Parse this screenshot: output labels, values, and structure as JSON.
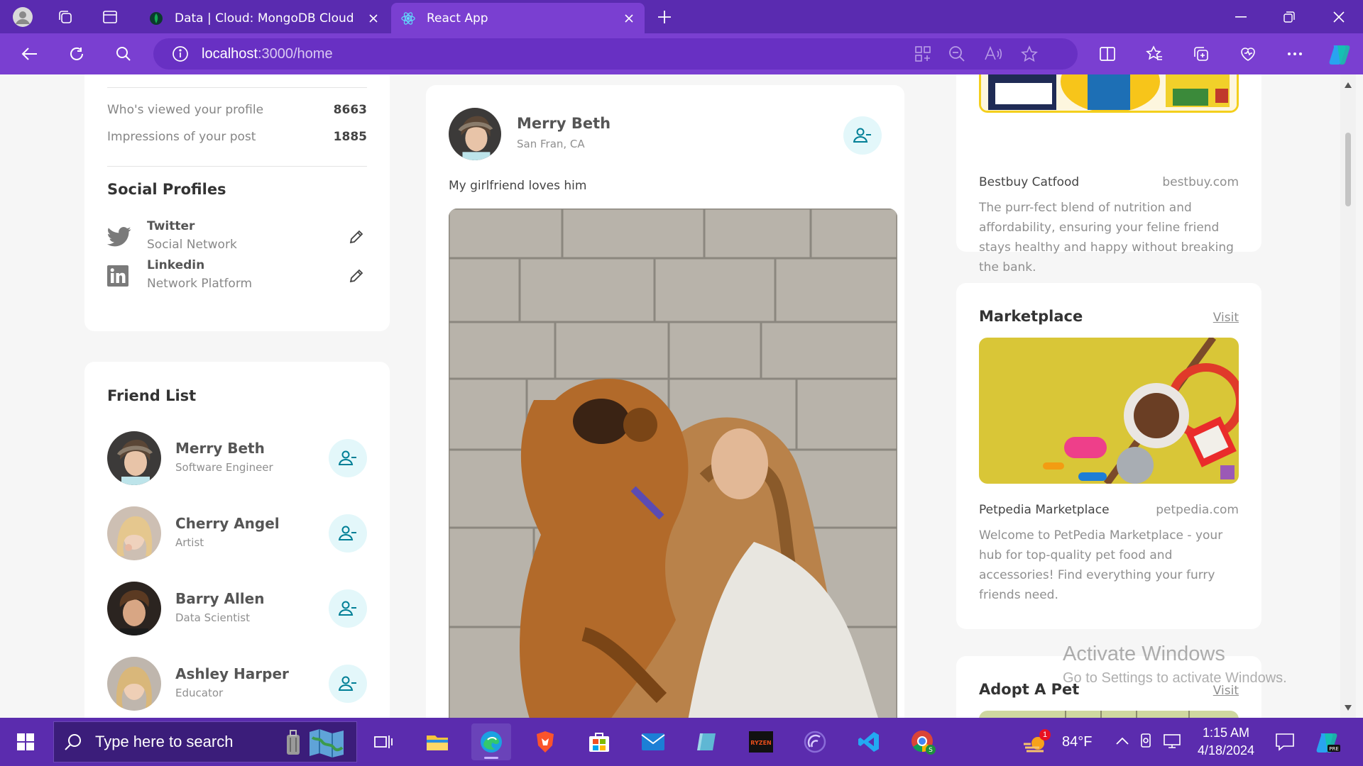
{
  "browser": {
    "tabs": [
      {
        "title": "Data | Cloud: MongoDB Cloud",
        "active": false
      },
      {
        "title": "React App",
        "active": true
      }
    ],
    "address": {
      "host": "localhost",
      "path": ":3000/home"
    }
  },
  "profile_stats": [
    {
      "label": "Who's viewed your profile",
      "value": "8663"
    },
    {
      "label": "Impressions of your post",
      "value": "1885"
    }
  ],
  "social_profiles": {
    "title": "Social Profiles",
    "items": [
      {
        "name": "Twitter",
        "type": "Social Network",
        "icon": "twitter-icon"
      },
      {
        "name": "Linkedin",
        "type": "Network Platform",
        "icon": "linkedin-icon"
      }
    ]
  },
  "friend_list": {
    "title": "Friend List",
    "friends": [
      {
        "name": "Merry Beth",
        "role": "Software Engineer"
      },
      {
        "name": "Cherry Angel",
        "role": "Artist"
      },
      {
        "name": "Barry Allen",
        "role": "Data Scientist"
      },
      {
        "name": "Ashley Harper",
        "role": "Educator"
      }
    ]
  },
  "post": {
    "author": "Merry Beth",
    "location": "San Fran, CA",
    "text": "My girlfriend loves him"
  },
  "ads": [
    {
      "name": "Bestbuy Catfood",
      "domain": "bestbuy.com",
      "description": "The purr-fect blend of nutrition and affordability, ensuring your feline friend stays healthy and happy without breaking the bank."
    },
    {
      "heading": "Marketplace",
      "visit": "Visit",
      "name": "Petpedia Marketplace",
      "domain": "petpedia.com",
      "description": "Welcome to PetPedia Marketplace - your hub for top-quality pet food and accessories! Find everything your furry friends need."
    },
    {
      "heading": "Adopt A Pet",
      "visit": "Visit"
    }
  ],
  "watermark": {
    "line1": "Activate Windows",
    "line2": "Go to Settings to activate Windows."
  },
  "taskbar": {
    "search_placeholder": "Type here to search",
    "weather": {
      "temp": "84°F",
      "badge": "1"
    },
    "time": "1:15 AM",
    "date": "4/18/2024"
  },
  "colors": {
    "accent": "#7a3fd1",
    "tabbar": "#5a2bb0",
    "teal": "#00a0bc",
    "teal_bg": "#e3f7fa"
  }
}
